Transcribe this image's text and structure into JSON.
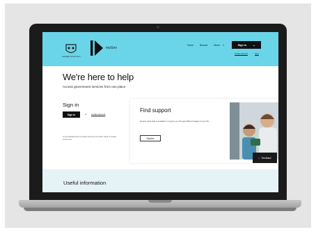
{
  "header": {
    "crest_text": "Australian Government",
    "brand_name": "myGov",
    "nav": [
      "Home",
      "Browse",
      "About"
    ],
    "signin_label": "Sign in",
    "sub_links": [
      "Create account",
      "Help"
    ]
  },
  "hero": {
    "title": "We're here to help",
    "subtitle": "Access government services from one place"
  },
  "signin_panel": {
    "title": "Sign in",
    "button_label": "Sign in",
    "or_text": "or",
    "create_link": "Create account",
    "note": "If you already have a myGov account you don't need to create a new one"
  },
  "support_card": {
    "title": "Find support",
    "text": "Explore what help is available to support you through different stages of your life",
    "button_label": "Explore",
    "feedback_label": "Feedback"
  },
  "useful_info": {
    "title": "Useful information"
  },
  "colors": {
    "header_bg": "#6ad5e8",
    "band_bg": "#e6f3f6",
    "frame_bg": "#e5e5e5",
    "laptop_bezel": "#1b1b1b"
  },
  "icons": [
    "crest-icon",
    "brand-arrow-icon",
    "search-icon",
    "chevron-down-icon",
    "chat-icon"
  ]
}
